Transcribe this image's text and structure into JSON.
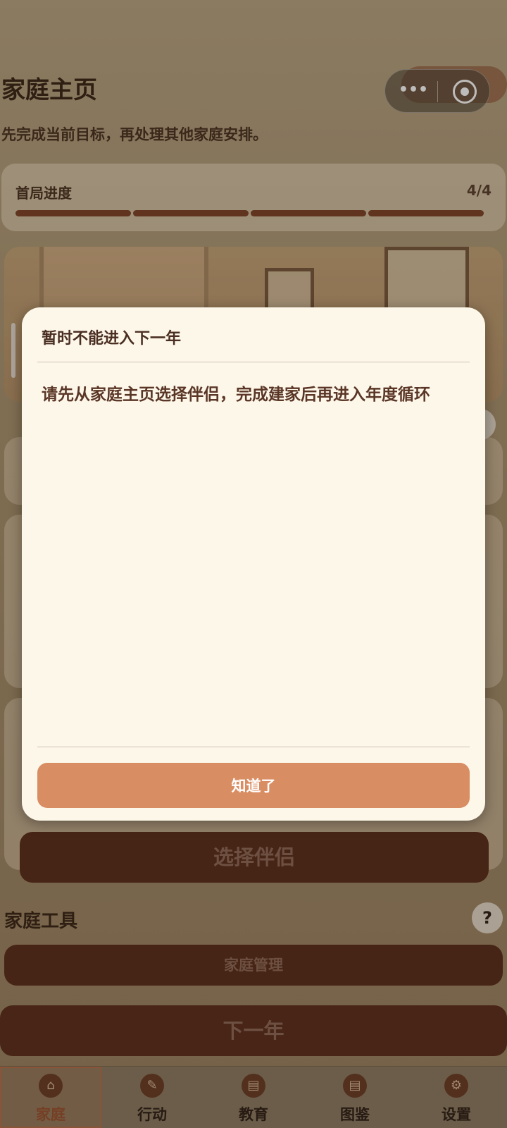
{
  "header": {
    "title": "家庭主页",
    "subtitle": "先完成当前目标，再处理其他家庭安排。",
    "capsule_more": "•••"
  },
  "progress": {
    "label": "首局进度",
    "count": "4/4",
    "segments_filled": 4,
    "segments_total": 4
  },
  "buttons": {
    "choose_partner": "选择伴侣",
    "family_manage": "家庭管理",
    "next_year": "下一年"
  },
  "tools_section": {
    "title": "家庭工具",
    "help": "?"
  },
  "other_help": "?",
  "tabbar": {
    "items": [
      {
        "label": "家庭",
        "icon": "house-icon",
        "active": true
      },
      {
        "label": "行动",
        "icon": "action-icon",
        "active": false
      },
      {
        "label": "教育",
        "icon": "book-icon",
        "active": false
      },
      {
        "label": "图鉴",
        "icon": "catalog-icon",
        "active": false
      },
      {
        "label": "设置",
        "icon": "gear-icon",
        "active": false
      }
    ]
  },
  "modal": {
    "title": "暂时不能进入下一年",
    "message": "请先从家庭主页选择伴侣，完成建家后再进入年度循环",
    "confirm": "知道了"
  },
  "colors": {
    "modal_bg": "#fdf7ea",
    "accent_button": "#d98d63",
    "brown_button": "#5a2e1c",
    "title_text": "#4a2e22"
  }
}
